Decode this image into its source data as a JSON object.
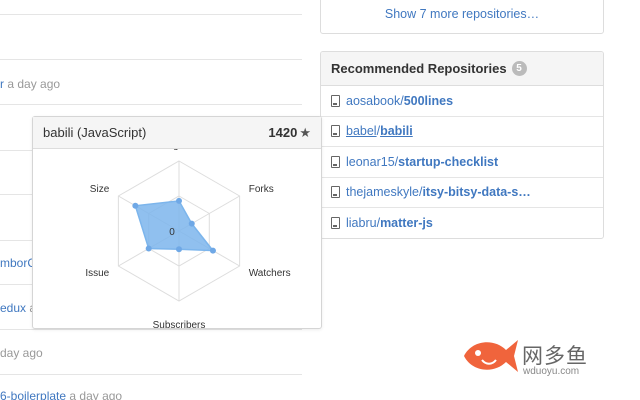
{
  "feed": {
    "snippets": [
      {
        "link": "r",
        "ago": "a day ago"
      },
      {
        "link": "mborCa",
        "ago": ""
      },
      {
        "link": "edux",
        "ago": "a"
      },
      {
        "link": "",
        "ago": "day ago"
      },
      {
        "link": "6-boilerplate",
        "ago": "a day ago"
      }
    ]
  },
  "sidebar": {
    "show_more": "Show 7 more repositories…",
    "recommended_title": "Recommended Repositories",
    "recommended_count": "5",
    "repos": [
      {
        "owner": "aosabook",
        "sep": "/",
        "name": "500lines"
      },
      {
        "owner": "babel",
        "sep": "/",
        "name": "babili"
      },
      {
        "owner": "leonar15",
        "sep": "/",
        "name": "startup-checklist"
      },
      {
        "owner": "thejameskyle",
        "sep": "/",
        "name": "itsy-bitsy-data-s…"
      },
      {
        "owner": "liabru",
        "sep": "/",
        "name": "matter-js"
      }
    ]
  },
  "popover": {
    "title": "babili (JavaScript)",
    "stars": "1420",
    "star_icon": "★"
  },
  "chart_data": {
    "type": "radar",
    "axes": [
      "Stargazers",
      "Forks",
      "Watchers",
      "Subscribers",
      "Issue",
      "Size"
    ],
    "center_label": "0",
    "values": [
      0.43,
      0.21,
      0.56,
      0.26,
      0.5,
      0.72
    ],
    "color": "#7cb5ec"
  },
  "watermark": {
    "text": "网多鱼",
    "sub": "wduoyu.com"
  }
}
